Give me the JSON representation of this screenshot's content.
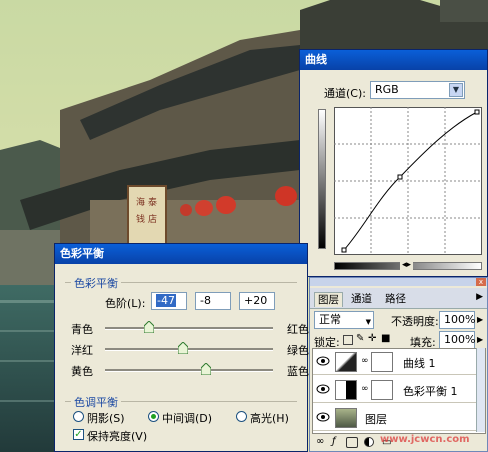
{
  "curves": {
    "title": "曲线",
    "channel_label": "通道(C):",
    "channel_value": "RGB",
    "slider_icon": "◂▸"
  },
  "color_balance": {
    "title": "色彩平衡",
    "section_title": "色彩平衡",
    "levels_label": "色阶(L):",
    "levels": [
      "-47",
      "-8",
      "+20"
    ],
    "sliders": [
      {
        "left": "青色",
        "right": "红色",
        "value": -47
      },
      {
        "left": "洋红",
        "right": "绿色",
        "value": -8
      },
      {
        "left": "黄色",
        "right": "蓝色",
        "value": 20
      }
    ],
    "tone_title": "色调平衡",
    "tone_options": [
      "阴影(S)",
      "中间调(D)",
      "高光(H)"
    ],
    "tone_selected": "中间调(D)",
    "preserve_label": "保持亮度(V)",
    "preserve_checked": true
  },
  "layers": {
    "tabs": [
      "图层",
      "通道",
      "路径"
    ],
    "active_tab": "图层",
    "blend_mode": "正常",
    "opacity_label": "不透明度:",
    "opacity_value": "100%",
    "lock_label": "锁定:",
    "fill_label": "填充:",
    "fill_value": "100%",
    "rows": [
      {
        "name": "曲线 1",
        "type": "curves"
      },
      {
        "name": "色彩平衡 1",
        "type": "balance"
      },
      {
        "name": "图层",
        "type": "image"
      }
    ]
  },
  "watermark": "www.jcwcn.com",
  "colors": {
    "titlebar": "#0a5fd8",
    "panel": "#ece9d8",
    "accent": "#316ac5"
  }
}
